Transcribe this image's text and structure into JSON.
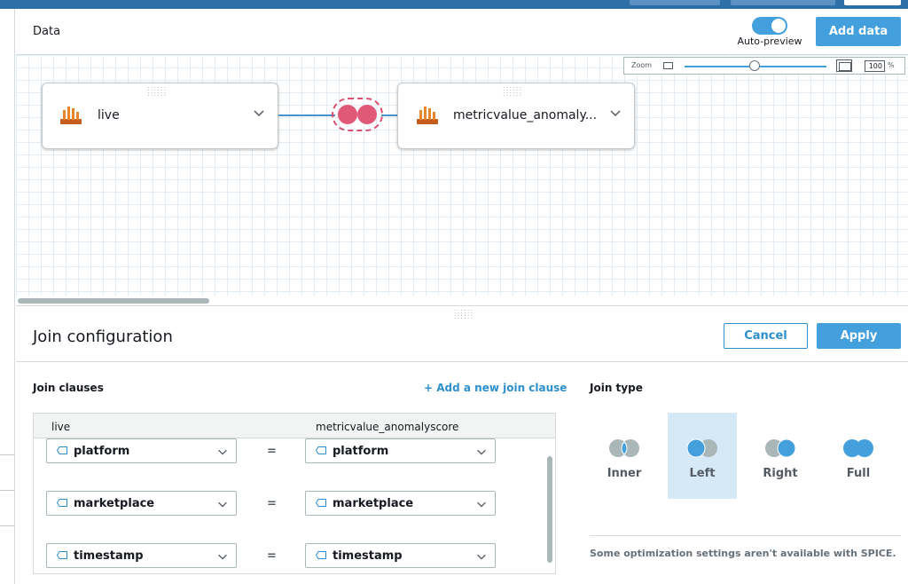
{
  "data_panel": {
    "title": "Data",
    "auto_preview_label": "Auto-preview",
    "auto_preview_on": true,
    "add_data_label": "Add data"
  },
  "zoom": {
    "label": "Zoom",
    "value": "100",
    "unit": "%",
    "slider_level_percent": 50
  },
  "nodes": [
    {
      "label": "live",
      "icon": "database-bars-icon"
    },
    {
      "label": "metricvalue_anomaly...",
      "icon": "database-bars-icon"
    }
  ],
  "join_config": {
    "title": "Join configuration",
    "cancel_label": "Cancel",
    "apply_label": "Apply",
    "clauses_title": "Join clauses",
    "add_clause_label": "+ Add a new join clause",
    "left_table": "live",
    "right_table": "metricvalue_anomalyscore",
    "equals": "=",
    "clauses": [
      {
        "left": "platform",
        "right": "platform"
      },
      {
        "left": "marketplace",
        "right": "marketplace"
      },
      {
        "left": "timestamp",
        "right": "timestamp"
      }
    ],
    "join_type_title": "Join type",
    "join_types": [
      {
        "label": "Inner",
        "selected": false
      },
      {
        "label": "Left",
        "selected": true
      },
      {
        "label": "Right",
        "selected": false
      },
      {
        "label": "Full",
        "selected": false
      }
    ],
    "spice_note": "Some optimization settings aren't available with SPICE."
  },
  "colors": {
    "accent": "#44a0dd",
    "join_badge": "#e05a78",
    "selected_bg": "#d6e9f6",
    "source_icon": "#e8862c"
  }
}
